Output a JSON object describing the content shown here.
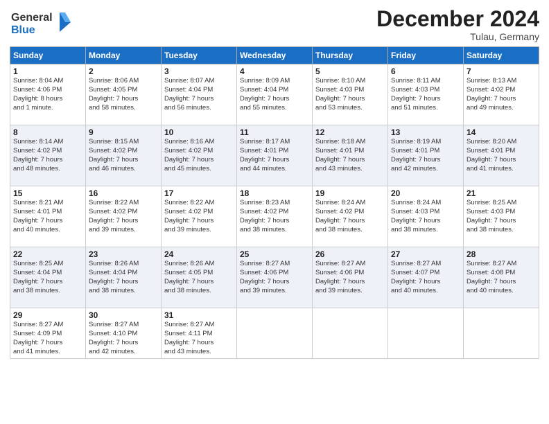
{
  "header": {
    "logo_line1": "General",
    "logo_line2": "Blue",
    "month": "December 2024",
    "location": "Tulau, Germany"
  },
  "weekdays": [
    "Sunday",
    "Monday",
    "Tuesday",
    "Wednesday",
    "Thursday",
    "Friday",
    "Saturday"
  ],
  "weeks": [
    [
      {
        "day": "1",
        "info": "Sunrise: 8:04 AM\nSunset: 4:06 PM\nDaylight: 8 hours\nand 1 minute."
      },
      {
        "day": "2",
        "info": "Sunrise: 8:06 AM\nSunset: 4:05 PM\nDaylight: 7 hours\nand 58 minutes."
      },
      {
        "day": "3",
        "info": "Sunrise: 8:07 AM\nSunset: 4:04 PM\nDaylight: 7 hours\nand 56 minutes."
      },
      {
        "day": "4",
        "info": "Sunrise: 8:09 AM\nSunset: 4:04 PM\nDaylight: 7 hours\nand 55 minutes."
      },
      {
        "day": "5",
        "info": "Sunrise: 8:10 AM\nSunset: 4:03 PM\nDaylight: 7 hours\nand 53 minutes."
      },
      {
        "day": "6",
        "info": "Sunrise: 8:11 AM\nSunset: 4:03 PM\nDaylight: 7 hours\nand 51 minutes."
      },
      {
        "day": "7",
        "info": "Sunrise: 8:13 AM\nSunset: 4:02 PM\nDaylight: 7 hours\nand 49 minutes."
      }
    ],
    [
      {
        "day": "8",
        "info": "Sunrise: 8:14 AM\nSunset: 4:02 PM\nDaylight: 7 hours\nand 48 minutes."
      },
      {
        "day": "9",
        "info": "Sunrise: 8:15 AM\nSunset: 4:02 PM\nDaylight: 7 hours\nand 46 minutes."
      },
      {
        "day": "10",
        "info": "Sunrise: 8:16 AM\nSunset: 4:02 PM\nDaylight: 7 hours\nand 45 minutes."
      },
      {
        "day": "11",
        "info": "Sunrise: 8:17 AM\nSunset: 4:01 PM\nDaylight: 7 hours\nand 44 minutes."
      },
      {
        "day": "12",
        "info": "Sunrise: 8:18 AM\nSunset: 4:01 PM\nDaylight: 7 hours\nand 43 minutes."
      },
      {
        "day": "13",
        "info": "Sunrise: 8:19 AM\nSunset: 4:01 PM\nDaylight: 7 hours\nand 42 minutes."
      },
      {
        "day": "14",
        "info": "Sunrise: 8:20 AM\nSunset: 4:01 PM\nDaylight: 7 hours\nand 41 minutes."
      }
    ],
    [
      {
        "day": "15",
        "info": "Sunrise: 8:21 AM\nSunset: 4:01 PM\nDaylight: 7 hours\nand 40 minutes."
      },
      {
        "day": "16",
        "info": "Sunrise: 8:22 AM\nSunset: 4:02 PM\nDaylight: 7 hours\nand 39 minutes."
      },
      {
        "day": "17",
        "info": "Sunrise: 8:22 AM\nSunset: 4:02 PM\nDaylight: 7 hours\nand 39 minutes."
      },
      {
        "day": "18",
        "info": "Sunrise: 8:23 AM\nSunset: 4:02 PM\nDaylight: 7 hours\nand 38 minutes."
      },
      {
        "day": "19",
        "info": "Sunrise: 8:24 AM\nSunset: 4:02 PM\nDaylight: 7 hours\nand 38 minutes."
      },
      {
        "day": "20",
        "info": "Sunrise: 8:24 AM\nSunset: 4:03 PM\nDaylight: 7 hours\nand 38 minutes."
      },
      {
        "day": "21",
        "info": "Sunrise: 8:25 AM\nSunset: 4:03 PM\nDaylight: 7 hours\nand 38 minutes."
      }
    ],
    [
      {
        "day": "22",
        "info": "Sunrise: 8:25 AM\nSunset: 4:04 PM\nDaylight: 7 hours\nand 38 minutes."
      },
      {
        "day": "23",
        "info": "Sunrise: 8:26 AM\nSunset: 4:04 PM\nDaylight: 7 hours\nand 38 minutes."
      },
      {
        "day": "24",
        "info": "Sunrise: 8:26 AM\nSunset: 4:05 PM\nDaylight: 7 hours\nand 38 minutes."
      },
      {
        "day": "25",
        "info": "Sunrise: 8:27 AM\nSunset: 4:06 PM\nDaylight: 7 hours\nand 39 minutes."
      },
      {
        "day": "26",
        "info": "Sunrise: 8:27 AM\nSunset: 4:06 PM\nDaylight: 7 hours\nand 39 minutes."
      },
      {
        "day": "27",
        "info": "Sunrise: 8:27 AM\nSunset: 4:07 PM\nDaylight: 7 hours\nand 40 minutes."
      },
      {
        "day": "28",
        "info": "Sunrise: 8:27 AM\nSunset: 4:08 PM\nDaylight: 7 hours\nand 40 minutes."
      }
    ],
    [
      {
        "day": "29",
        "info": "Sunrise: 8:27 AM\nSunset: 4:09 PM\nDaylight: 7 hours\nand 41 minutes."
      },
      {
        "day": "30",
        "info": "Sunrise: 8:27 AM\nSunset: 4:10 PM\nDaylight: 7 hours\nand 42 minutes."
      },
      {
        "day": "31",
        "info": "Sunrise: 8:27 AM\nSunset: 4:11 PM\nDaylight: 7 hours\nand 43 minutes."
      },
      {
        "day": "",
        "info": ""
      },
      {
        "day": "",
        "info": ""
      },
      {
        "day": "",
        "info": ""
      },
      {
        "day": "",
        "info": ""
      }
    ]
  ]
}
